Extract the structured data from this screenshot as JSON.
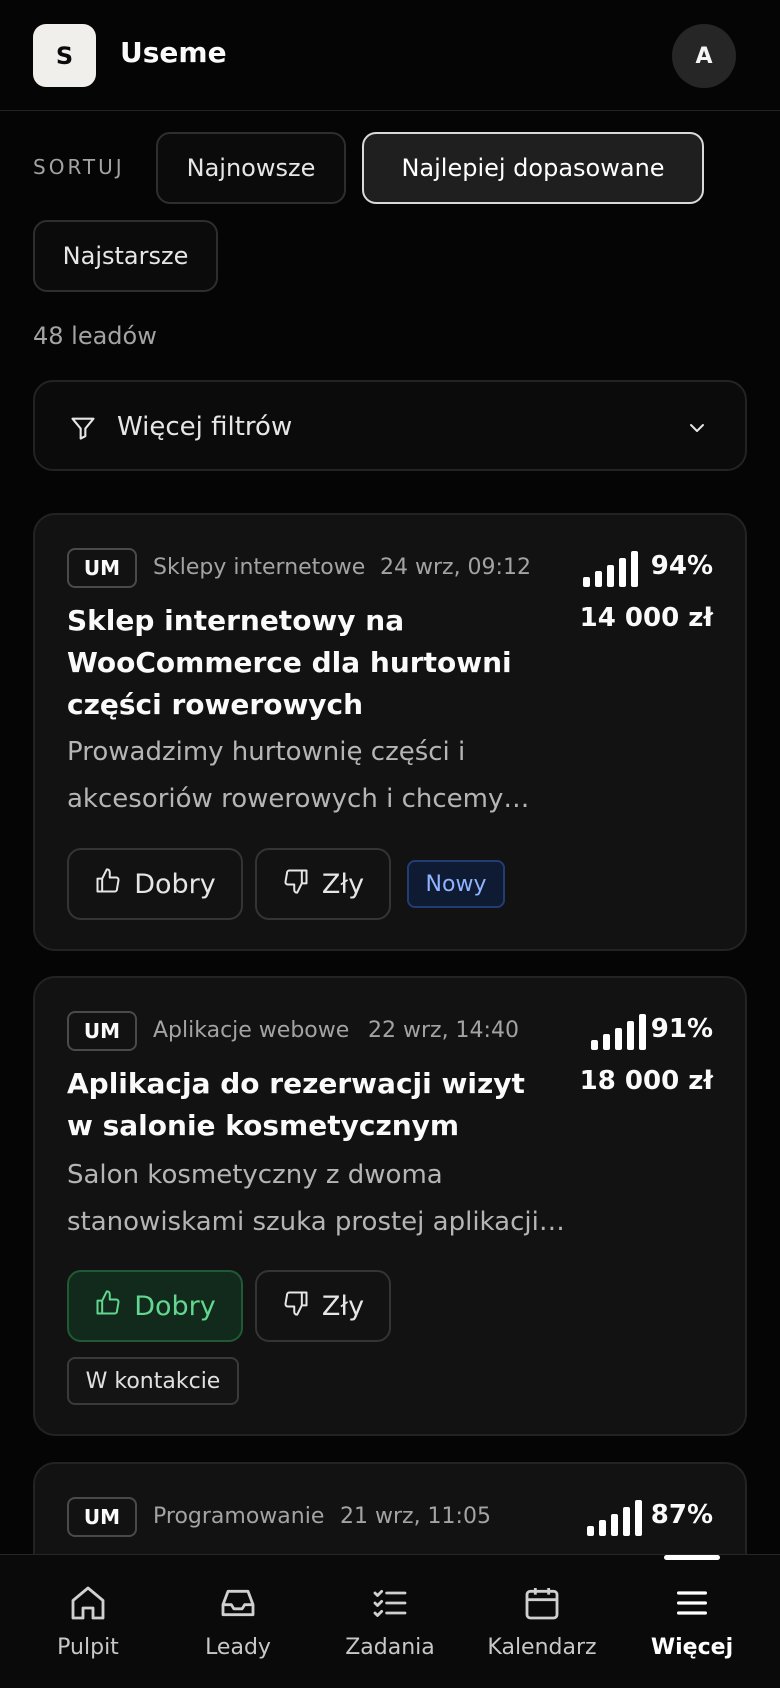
{
  "app": {
    "logo_letter": "S",
    "name": "Useme",
    "avatar_letter": "A"
  },
  "sort": {
    "label": "SORTUJ",
    "options": [
      "Najnowsze",
      "Najlepiej dopasowane",
      "Najstarsze"
    ],
    "selected": "Najlepiej dopasowane"
  },
  "lead_count": "48 leadów",
  "filters": {
    "label": "Więcej filtrów"
  },
  "leads": [
    {
      "source": "UM",
      "category": "Sklepy internetowe",
      "date": "24 wrz, 09:12",
      "match": "94%",
      "budget": "14 000 zł",
      "title": "Sklep internetowy na WooCommerce dla hurtowni części rowerowych",
      "description": "Prowadzimy hurtownię części i akcesoriów rowerowych i chcemy…",
      "good_label": "Dobry",
      "bad_label": "Zły",
      "rating": "none",
      "status": "Nowy"
    },
    {
      "source": "UM",
      "category": "Aplikacje webowe",
      "date": "22 wrz, 14:40",
      "match": "91%",
      "budget": "18 000 zł",
      "title": "Aplikacja do rezerwacji wizyt w salonie kosmetycznym",
      "description": "Salon kosmetyczny z dwoma stanowiskami szuka prostej aplikacji…",
      "good_label": "Dobry",
      "bad_label": "Zły",
      "rating": "good",
      "status": "W kontakcie"
    },
    {
      "source": "UM",
      "category": "Programowanie",
      "date": "21 wrz, 11:05",
      "match": "87%"
    }
  ],
  "nav": {
    "items": [
      {
        "label": "Pulpit",
        "icon": "home-icon"
      },
      {
        "label": "Leady",
        "icon": "inbox-icon"
      },
      {
        "label": "Zadania",
        "icon": "checklist-icon"
      },
      {
        "label": "Kalendarz",
        "icon": "calendar-icon"
      },
      {
        "label": "Więcej",
        "icon": "menu-icon"
      }
    ],
    "active": "Więcej"
  },
  "colors": {
    "background": "#050505",
    "card": "#121212",
    "good_selected": "#62d78f",
    "status_new": "#8fb4ff"
  }
}
